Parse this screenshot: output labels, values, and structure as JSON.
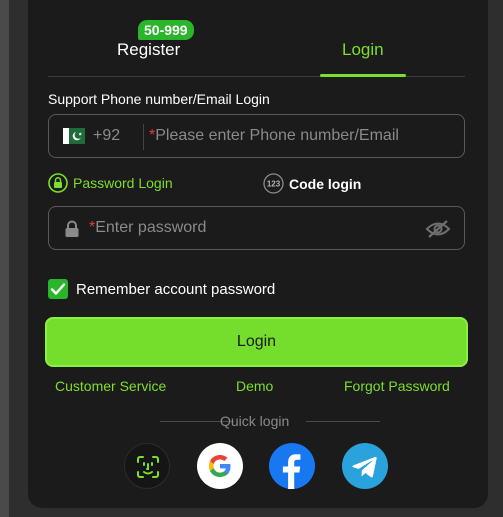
{
  "tabs": {
    "register_label": "Register",
    "register_badge": "50-999",
    "login_label": "Login"
  },
  "login_form": {
    "section_label": "Support Phone number/Email Login",
    "country_code": "+92",
    "required_mark": "*",
    "phone_placeholder": "Please enter Phone number/Email",
    "password_method_label": "Password Login",
    "code_method_label": "Code login",
    "code_icon_text": "123",
    "password_placeholder": "Enter password",
    "remember_label": "Remember account password",
    "remember_checked": true,
    "login_button_label": "Login"
  },
  "links": {
    "customer_service": "Customer Service",
    "demo": "Demo",
    "forgot_password": "Forgot Password"
  },
  "quick_login": {
    "label": "Quick login",
    "providers": [
      "face-id-icon",
      "google-icon",
      "facebook-icon",
      "telegram-icon"
    ]
  },
  "colors": {
    "accent": "#7dde2d",
    "button": "#75dd2c",
    "badge": "#2bb52b",
    "panel": "#1b1b1b",
    "required": "#e23b3b"
  },
  "icons": {
    "flag": "pakistan-flag-icon",
    "lock": "lock-icon",
    "eye": "eye-off-icon",
    "check": "checkmark-icon"
  }
}
